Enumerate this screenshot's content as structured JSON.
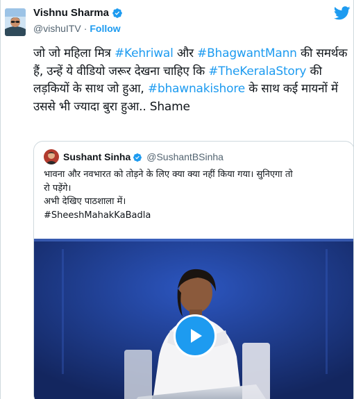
{
  "author": {
    "name": "Vishnu Sharma",
    "handle": "@vishuITV",
    "separator": "·",
    "follow_label": "Follow"
  },
  "icons": {
    "verified": "verified-badge-icon",
    "brand": "twitter-bird-icon",
    "play": "play-icon"
  },
  "colors": {
    "accent": "#1d9bf0",
    "text": "#0f1419",
    "muted": "#536471",
    "media_bg": "#1d3b88"
  },
  "tweet": {
    "segments": [
      "जो जो महिला मित्र ",
      "#Kehriwal",
      " और ",
      "#BhagwantMann",
      " की समर्थक हैं, उन्हें ये वीडियो जरूर देखना चाहिए कि ",
      "#TheKeralaStory",
      " की लड़कियों के साथ जो हुआ, ",
      "#bhawnakishore",
      " के साथ कई मायनों में उससे भी ज्यादा बुरा हुआ.. Shame"
    ]
  },
  "quoted": {
    "name": "Sushant Sinha",
    "handle": "@SushantBSinha",
    "lines": [
      "भावना और नवभारत को तोड़ने के लिए क्या क्या नहीं किया गया। सुनिएगा तो",
      "रो पड़ेंगे।",
      "अभी देखिए पाठशाला में।",
      "#SheeshMahakKaBadla"
    ]
  }
}
